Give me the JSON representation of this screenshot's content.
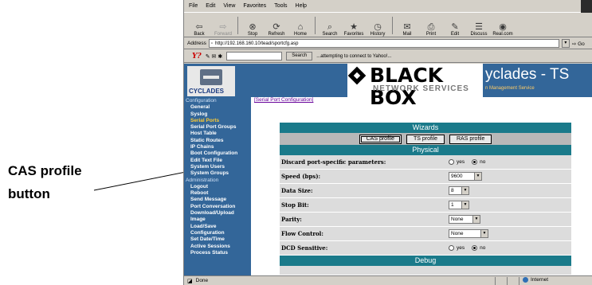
{
  "callout": {
    "label": "CAS profile button"
  },
  "browser": {
    "menu": [
      "File",
      "Edit",
      "View",
      "Favorites",
      "Tools",
      "Help"
    ],
    "toolbar": [
      {
        "label": "Back",
        "icon": "back-arrow-icon",
        "enabled": true
      },
      {
        "label": "Forward",
        "icon": "forward-arrow-icon",
        "enabled": false
      },
      {
        "label": "Stop",
        "icon": "stop-icon",
        "enabled": true
      },
      {
        "label": "Refresh",
        "icon": "refresh-icon",
        "enabled": true
      },
      {
        "label": "Home",
        "icon": "home-icon",
        "enabled": true
      },
      {
        "label": "Search",
        "icon": "search-icon",
        "enabled": true
      },
      {
        "label": "Favorites",
        "icon": "favorites-icon",
        "enabled": true
      },
      {
        "label": "History",
        "icon": "history-icon",
        "enabled": true
      },
      {
        "label": "Mail",
        "icon": "mail-icon",
        "enabled": true
      },
      {
        "label": "Print",
        "icon": "print-icon",
        "enabled": true
      },
      {
        "label": "Edit",
        "icon": "edit-icon",
        "enabled": true
      },
      {
        "label": "Discuss",
        "icon": "discuss-icon",
        "enabled": true
      },
      {
        "label": "Real.com",
        "icon": "realcom-icon",
        "enabled": true
      }
    ],
    "address_label": "Address",
    "address_url": "http://192.168.160.10/tead/sportcfg.asp",
    "go_label": "Go",
    "yahoo": {
      "search_button": "Search",
      "status_text": "...attempting to connect to Yahoo!..."
    },
    "status": {
      "text": "Done",
      "zone": "Internet"
    }
  },
  "banner": {
    "logo_text": "CYCLADES",
    "brand_name": "BLACK BOX",
    "brand_sub": "NETWORK SERVICES",
    "product_title": "yclades - TS",
    "product_subtitle": "n Management Service"
  },
  "sidebar": {
    "sections": [
      {
        "heading": "Configuration",
        "items": [
          {
            "label": "General",
            "active": false
          },
          {
            "label": "Syslog",
            "active": false
          },
          {
            "label": "Serial Ports",
            "active": true
          },
          {
            "label": "Serial Port Groups",
            "active": false
          },
          {
            "label": "Host Table",
            "active": false
          },
          {
            "label": "Static Routes",
            "active": false
          },
          {
            "label": "IP Chains",
            "active": false
          },
          {
            "label": "Boot Configuration",
            "active": false
          },
          {
            "label": "Edit Text File",
            "active": false
          },
          {
            "label": "System Users",
            "active": false
          },
          {
            "label": "System Groups",
            "active": false
          }
        ]
      },
      {
        "heading": "Administration",
        "items": [
          {
            "label": "Logout",
            "active": false
          },
          {
            "label": "Reboot",
            "active": false
          },
          {
            "label": "Send Message",
            "active": false
          },
          {
            "label": "Port Conversation",
            "active": false
          },
          {
            "label": "Download/Upload",
            "active": false
          },
          {
            "label": "Image",
            "active": false
          },
          {
            "label": "Load/Save",
            "active": false
          },
          {
            "label": "Configuration",
            "active": false
          },
          {
            "label": "Set Date/Time",
            "active": false
          },
          {
            "label": "Active Sessions",
            "active": false
          },
          {
            "label": "Process Status",
            "active": false
          }
        ]
      }
    ]
  },
  "main": {
    "breadcrumb": "[Serial Port Configuration]",
    "wizards": {
      "title": "Wizards",
      "buttons": [
        "CAS profile",
        "TS profile",
        "RAS profile"
      ]
    },
    "physical": {
      "title": "Physical",
      "rows": [
        {
          "label": "Discard port-specific parameters:",
          "type": "radio",
          "options": [
            "yes",
            "no"
          ],
          "selected": "no"
        },
        {
          "label": "Speed (bps):",
          "type": "select",
          "value": "9600"
        },
        {
          "label": "Data Size:",
          "type": "select",
          "value": "8"
        },
        {
          "label": "Stop Bit:",
          "type": "select",
          "value": "1"
        },
        {
          "label": "Parity:",
          "type": "select",
          "value": "None"
        },
        {
          "label": "Flow Control:",
          "type": "select",
          "value": "None"
        },
        {
          "label": "DCD Sensitive:",
          "type": "radio",
          "options": [
            "yes",
            "no"
          ],
          "selected": "no"
        }
      ]
    },
    "debug": {
      "title": "Debug"
    }
  }
}
